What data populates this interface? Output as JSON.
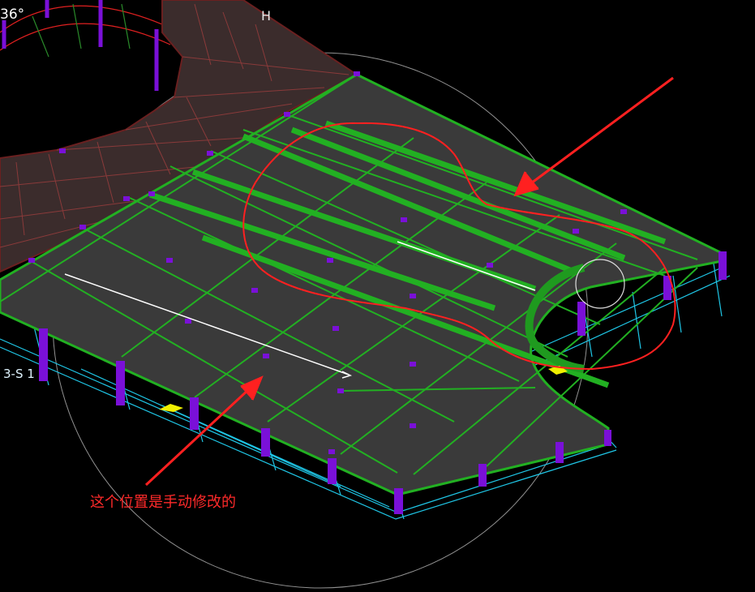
{
  "view": {
    "rotation_angle": "36°",
    "axis_label": "H",
    "grid_label": "3-S 1"
  },
  "annotation": {
    "text": "这个位置是手动修改的"
  },
  "colors": {
    "background": "#000000",
    "slab_fill": "#3a3a3a",
    "beam_green": "#22b022",
    "column_purple": "#7a10d8",
    "grid_cyan": "#1fc6e6",
    "markup_red": "#ff2020",
    "ring_deck": "#3b2c2c",
    "ring_lines": "#8a3a3a",
    "cursor_white": "#ffffff"
  }
}
